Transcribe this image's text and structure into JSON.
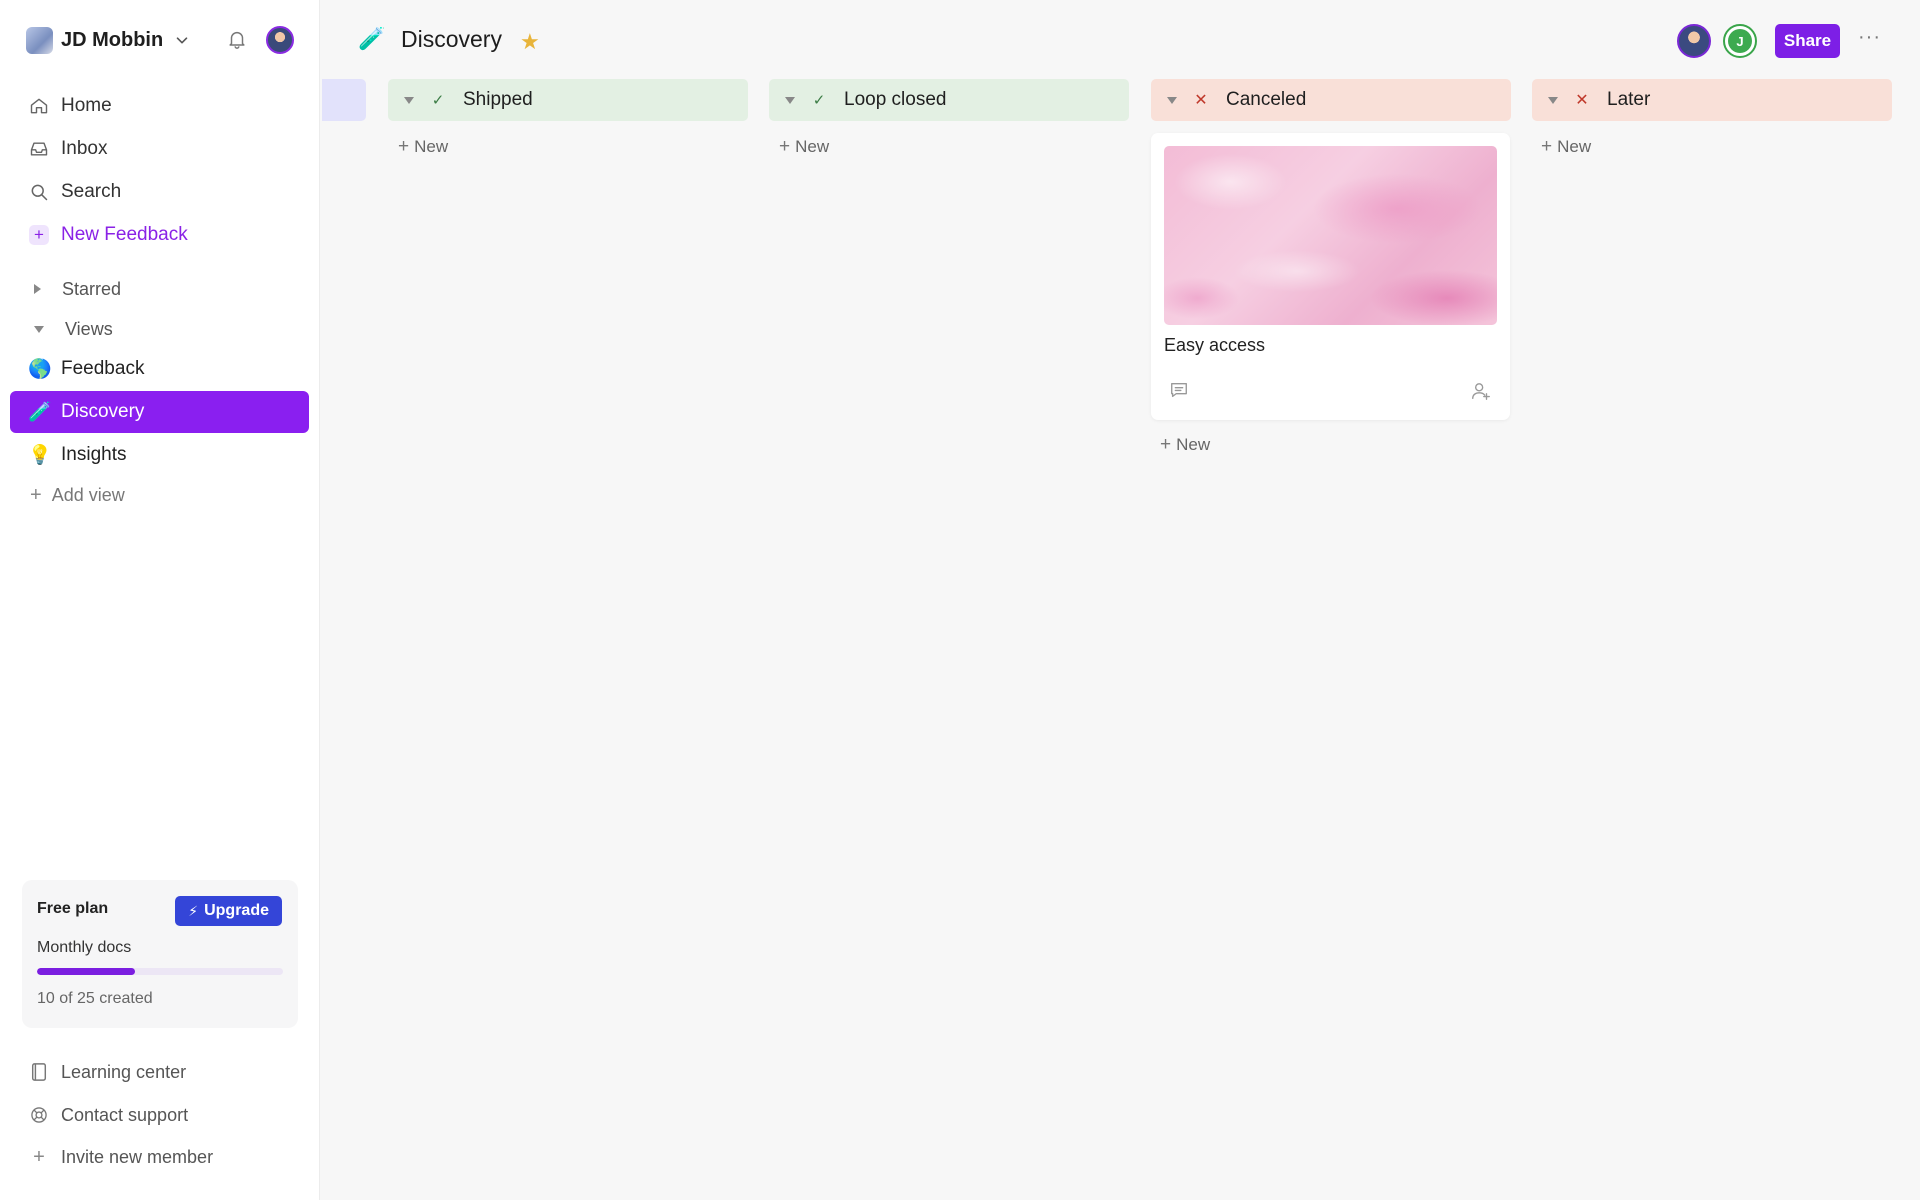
{
  "workspace": {
    "name": "JD Mobbin"
  },
  "nav": {
    "home": "Home",
    "inbox": "Inbox",
    "search": "Search",
    "new_feedback": "New Feedback"
  },
  "sections": {
    "starred": "Starred",
    "views": "Views"
  },
  "views": [
    {
      "emoji": "🌎",
      "label": "Feedback"
    },
    {
      "emoji": "🧪",
      "label": "Discovery",
      "active": true
    },
    {
      "emoji": "💡",
      "label": "Insights"
    }
  ],
  "add_view": "Add view",
  "plan": {
    "title": "Free plan",
    "upgrade_label": "Upgrade",
    "subtitle": "Monthly docs",
    "used": 10,
    "total": 25,
    "count_text": "10 of 25 created"
  },
  "footer": {
    "learning": "Learning center",
    "support": "Contact support",
    "invite": "Invite new member"
  },
  "page": {
    "emoji": "🧪",
    "title": "Discovery"
  },
  "header": {
    "share_label": "Share",
    "collaborator_initial": "J",
    "more": "···"
  },
  "columns": [
    {
      "name": "Shipped",
      "status": "done",
      "new_label": "New"
    },
    {
      "name": "Loop closed",
      "status": "done",
      "new_label": "New"
    },
    {
      "name": "Canceled",
      "status": "canceled",
      "new_label": "New"
    },
    {
      "name": "Later",
      "status": "canceled",
      "new_label": "New"
    }
  ],
  "card": {
    "title": "Easy access"
  },
  "colors": {
    "accent": "#8a1ff0",
    "upgrade": "#3445d8",
    "done_header": "#e3f0e3",
    "canceled_header": "#f9e0d8",
    "partial_column": "#e2e2fb"
  }
}
